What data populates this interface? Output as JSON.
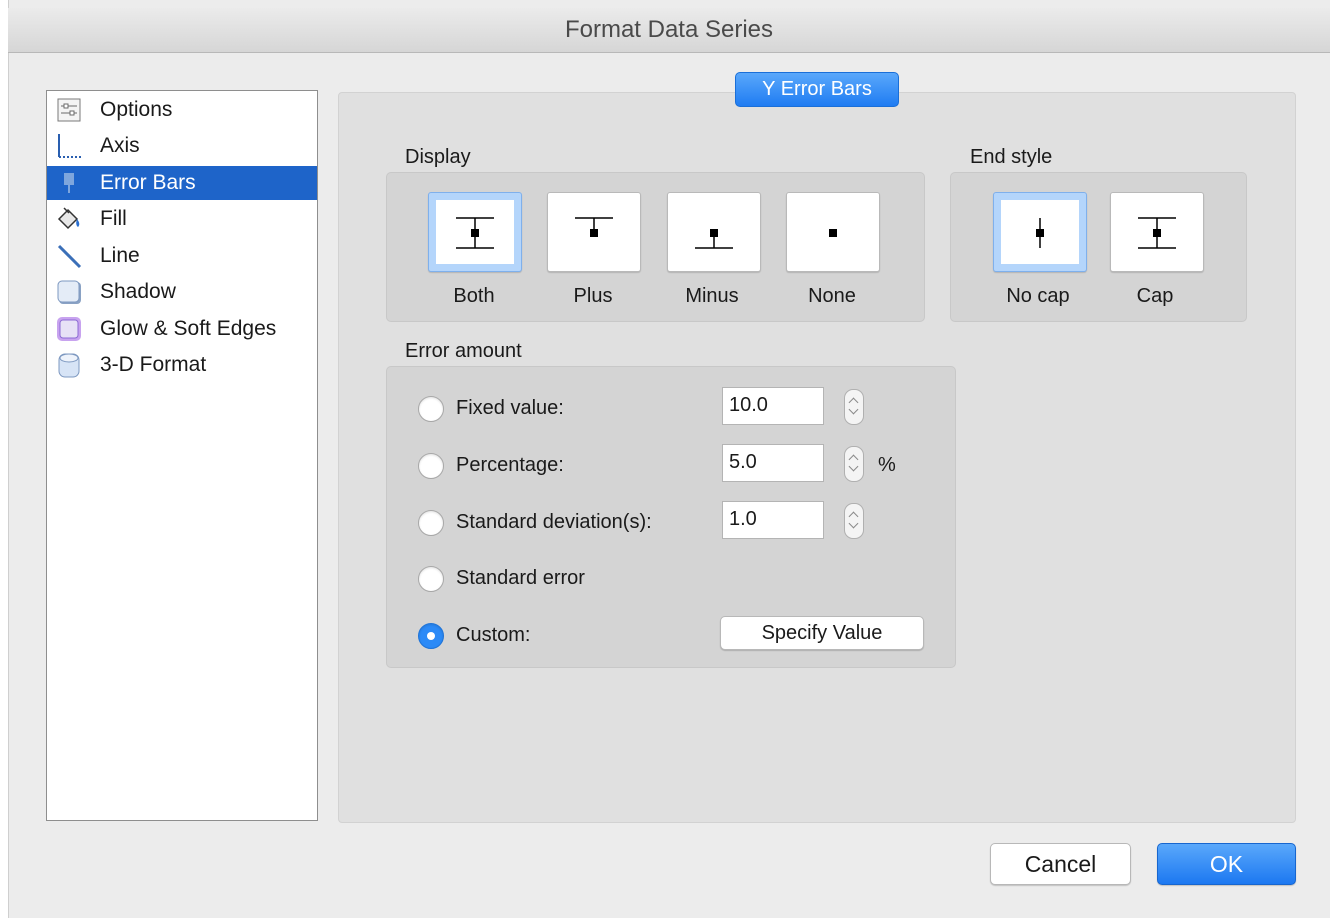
{
  "window": {
    "title": "Format Data Series"
  },
  "sidebar": {
    "items": [
      {
        "label": "Options",
        "icon": "options-icon",
        "selected": false
      },
      {
        "label": "Axis",
        "icon": "axis-icon",
        "selected": false
      },
      {
        "label": "Error Bars",
        "icon": "error-bars-icon",
        "selected": true
      },
      {
        "label": "Fill",
        "icon": "fill-bucket-icon",
        "selected": false
      },
      {
        "label": "Line",
        "icon": "line-icon",
        "selected": false
      },
      {
        "label": "Shadow",
        "icon": "shadow-icon",
        "selected": false
      },
      {
        "label": "Glow & Soft Edges",
        "icon": "glow-icon",
        "selected": false
      },
      {
        "label": "3-D Format",
        "icon": "3d-format-icon",
        "selected": false
      }
    ]
  },
  "tab": {
    "label": "Y Error Bars"
  },
  "display": {
    "label": "Display",
    "options": [
      {
        "label": "Both",
        "selected": true
      },
      {
        "label": "Plus",
        "selected": false
      },
      {
        "label": "Minus",
        "selected": false
      },
      {
        "label": "None",
        "selected": false
      }
    ]
  },
  "end_style": {
    "label": "End style",
    "options": [
      {
        "label": "No cap",
        "selected": true
      },
      {
        "label": "Cap",
        "selected": false
      }
    ]
  },
  "error_amount": {
    "label": "Error amount",
    "fixed": {
      "label": "Fixed value:",
      "value": "10.0",
      "checked": false
    },
    "percentage": {
      "label": "Percentage:",
      "value": "5.0",
      "unit": "%",
      "checked": false
    },
    "stddev": {
      "label": "Standard deviation(s):",
      "value": "1.0",
      "checked": false
    },
    "stderr": {
      "label": "Standard error",
      "checked": false
    },
    "custom": {
      "label": "Custom:",
      "checked": true,
      "button": "Specify Value"
    }
  },
  "footer": {
    "cancel": "Cancel",
    "ok": "OK"
  },
  "colors": {
    "accent": "#1f7cf2",
    "selection": "#1e64c9",
    "panel": "#e0e0e0"
  }
}
